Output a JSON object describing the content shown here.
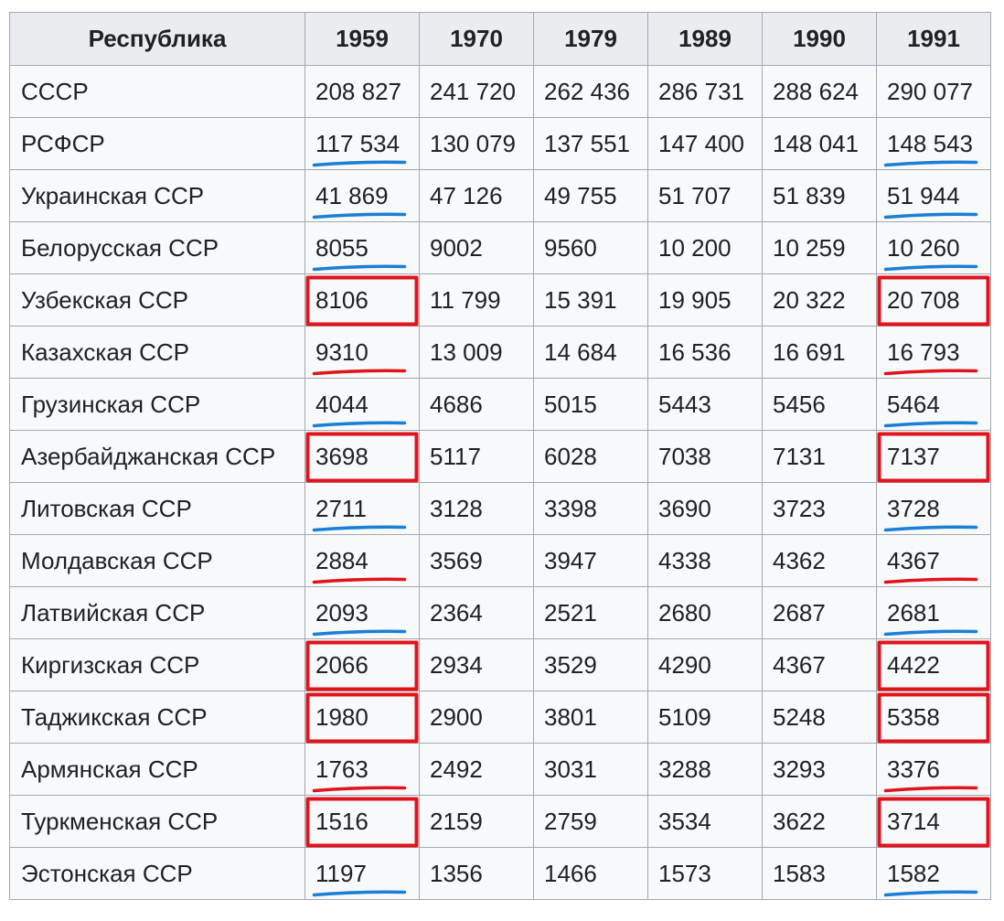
{
  "table": {
    "headers": [
      "Республика",
      "1959",
      "1970",
      "1979",
      "1989",
      "1990",
      "1991"
    ],
    "rows": [
      [
        "СССР",
        "208 827",
        "241 720",
        "262 436",
        "286 731",
        "288 624",
        "290 077"
      ],
      [
        "РСФСР",
        "117 534",
        "130 079",
        "137 551",
        "147 400",
        "148 041",
        "148 543"
      ],
      [
        "Украинская ССР",
        "41 869",
        "47 126",
        "49 755",
        "51 707",
        "51 839",
        "51 944"
      ],
      [
        "Белорусская ССР",
        "8055",
        "9002",
        "9560",
        "10 200",
        "10 259",
        "10 260"
      ],
      [
        "Узбекская ССР",
        "8106",
        "11 799",
        "15 391",
        "19 905",
        "20 322",
        "20 708"
      ],
      [
        "Казахская ССР",
        "9310",
        "13 009",
        "14 684",
        "16 536",
        "16 691",
        "16 793"
      ],
      [
        "Грузинская ССР",
        "4044",
        "4686",
        "5015",
        "5443",
        "5456",
        "5464"
      ],
      [
        "Азербайджанская ССР",
        "3698",
        "5117",
        "6028",
        "7038",
        "7131",
        "7137"
      ],
      [
        "Литовская ССР",
        "2711",
        "3128",
        "3398",
        "3690",
        "3723",
        "3728"
      ],
      [
        "Молдавская ССР",
        "2884",
        "3569",
        "3947",
        "4338",
        "4362",
        "4367"
      ],
      [
        "Латвийская ССР",
        "2093",
        "2364",
        "2521",
        "2680",
        "2687",
        "2681"
      ],
      [
        "Киргизская ССР",
        "2066",
        "2934",
        "3529",
        "4290",
        "4367",
        "4422"
      ],
      [
        "Таджикская ССР",
        "1980",
        "2900",
        "3801",
        "5109",
        "5248",
        "5358"
      ],
      [
        "Армянская ССР",
        "1763",
        "2492",
        "3031",
        "3288",
        "3293",
        "3376"
      ],
      [
        "Туркменская ССР",
        "1516",
        "2159",
        "2759",
        "3534",
        "3622",
        "3714"
      ],
      [
        "Эстонская ССР",
        "1197",
        "1356",
        "1466",
        "1573",
        "1583",
        "1582"
      ]
    ]
  },
  "annotations": {
    "colors": {
      "red": "#e0141c",
      "blue": "#1a7fd6"
    },
    "marks": [
      {
        "row": 1,
        "col": 1,
        "kind": "underline",
        "color": "blue"
      },
      {
        "row": 1,
        "col": 6,
        "kind": "underline",
        "color": "blue"
      },
      {
        "row": 2,
        "col": 1,
        "kind": "underline",
        "color": "blue"
      },
      {
        "row": 2,
        "col": 6,
        "kind": "underline",
        "color": "blue"
      },
      {
        "row": 3,
        "col": 1,
        "kind": "underline",
        "color": "blue"
      },
      {
        "row": 3,
        "col": 6,
        "kind": "underline",
        "color": "blue"
      },
      {
        "row": 4,
        "col": 1,
        "kind": "box",
        "color": "red"
      },
      {
        "row": 4,
        "col": 6,
        "kind": "box",
        "color": "red"
      },
      {
        "row": 5,
        "col": 1,
        "kind": "underline",
        "color": "red"
      },
      {
        "row": 5,
        "col": 6,
        "kind": "underline",
        "color": "red"
      },
      {
        "row": 6,
        "col": 1,
        "kind": "underline",
        "color": "blue"
      },
      {
        "row": 6,
        "col": 6,
        "kind": "underline",
        "color": "blue"
      },
      {
        "row": 7,
        "col": 1,
        "kind": "box",
        "color": "red"
      },
      {
        "row": 7,
        "col": 6,
        "kind": "box",
        "color": "red"
      },
      {
        "row": 8,
        "col": 1,
        "kind": "underline",
        "color": "blue"
      },
      {
        "row": 8,
        "col": 6,
        "kind": "underline",
        "color": "blue"
      },
      {
        "row": 9,
        "col": 1,
        "kind": "underline",
        "color": "red"
      },
      {
        "row": 9,
        "col": 6,
        "kind": "underline",
        "color": "red"
      },
      {
        "row": 10,
        "col": 1,
        "kind": "underline",
        "color": "blue"
      },
      {
        "row": 10,
        "col": 6,
        "kind": "underline",
        "color": "blue"
      },
      {
        "row": 11,
        "col": 1,
        "kind": "box",
        "color": "red"
      },
      {
        "row": 11,
        "col": 6,
        "kind": "box",
        "color": "red"
      },
      {
        "row": 12,
        "col": 1,
        "kind": "box",
        "color": "red"
      },
      {
        "row": 12,
        "col": 6,
        "kind": "box",
        "color": "red"
      },
      {
        "row": 13,
        "col": 1,
        "kind": "underline",
        "color": "red"
      },
      {
        "row": 13,
        "col": 6,
        "kind": "underline",
        "color": "red"
      },
      {
        "row": 14,
        "col": 1,
        "kind": "box",
        "color": "red"
      },
      {
        "row": 14,
        "col": 6,
        "kind": "box",
        "color": "red"
      },
      {
        "row": 15,
        "col": 1,
        "kind": "underline",
        "color": "blue"
      },
      {
        "row": 15,
        "col": 6,
        "kind": "underline",
        "color": "blue"
      }
    ]
  }
}
